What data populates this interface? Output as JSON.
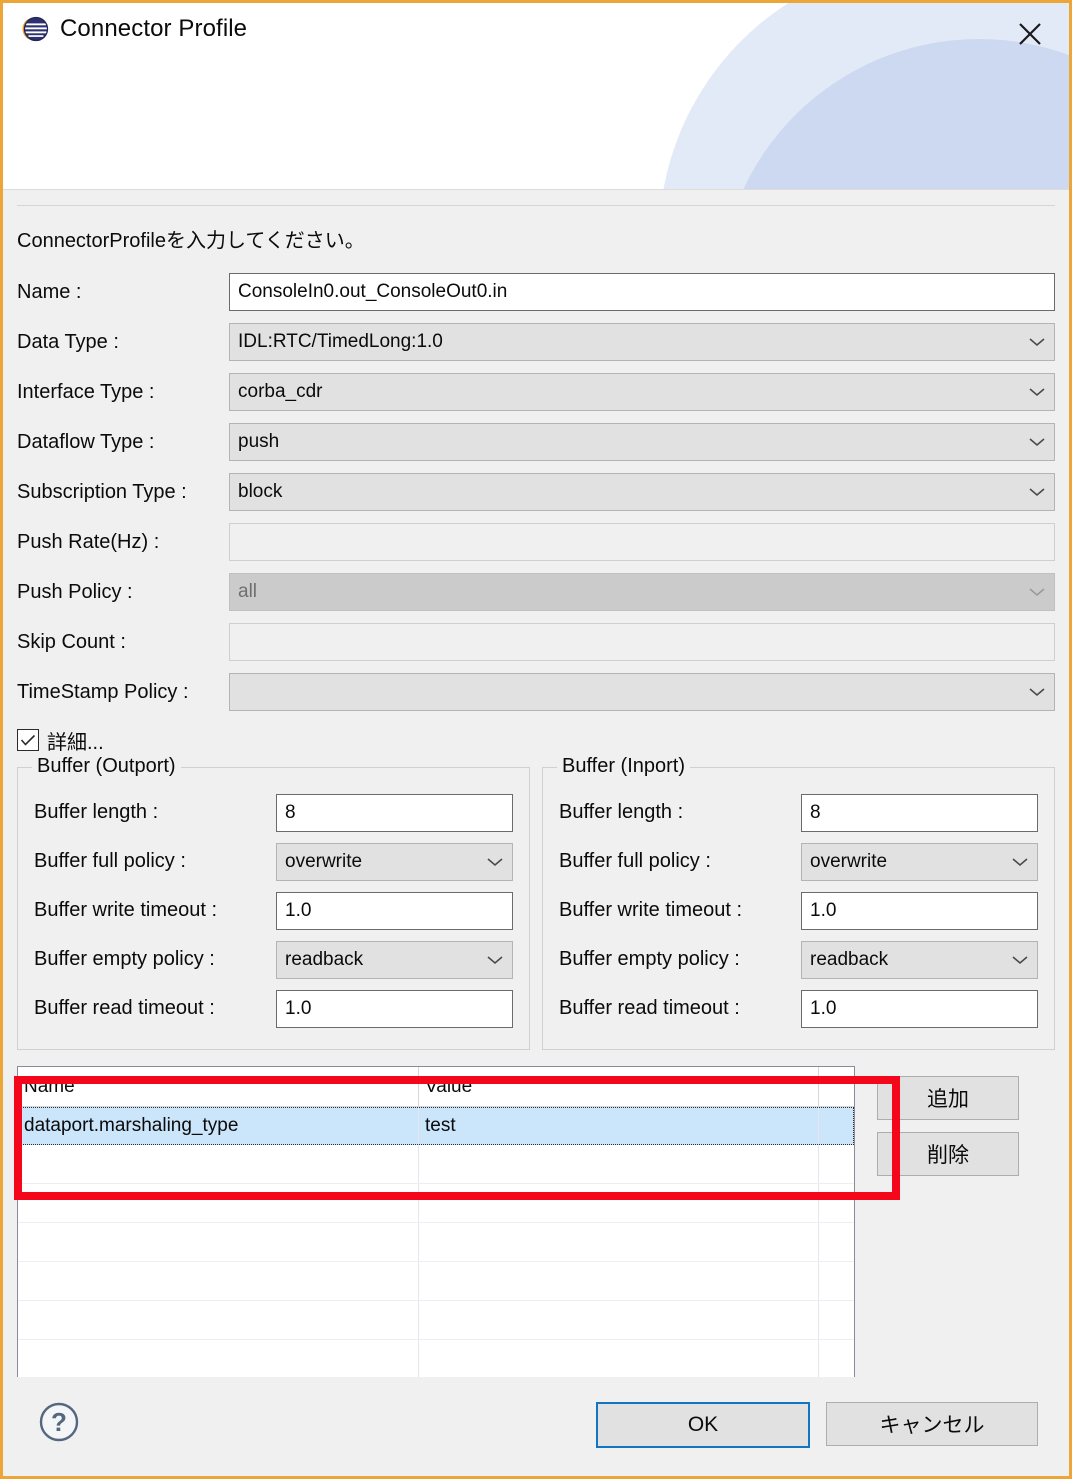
{
  "window": {
    "title": "Connector Profile",
    "app_icon": "connector-profile-icon",
    "close_icon": "close-icon",
    "border_color": "#eba637"
  },
  "intro": "ConnectorProfileを入力してください。",
  "form": {
    "fields": [
      {
        "label": "Name :",
        "value": "ConsoleIn0.out_ConsoleOut0.in",
        "type": "text",
        "state": "enabled"
      },
      {
        "label": "Data Type :",
        "value": "IDL:RTC/TimedLong:1.0",
        "type": "combo",
        "state": "enabled"
      },
      {
        "label": "Interface Type :",
        "value": "corba_cdr",
        "type": "combo",
        "state": "enabled"
      },
      {
        "label": "Dataflow Type :",
        "value": "push",
        "type": "combo",
        "state": "enabled"
      },
      {
        "label": "Subscription Type :",
        "value": "block",
        "type": "combo",
        "state": "enabled"
      },
      {
        "label": "Push Rate(Hz) :",
        "value": "",
        "type": "text",
        "state": "disabled"
      },
      {
        "label": "Push Policy :",
        "value": "all",
        "type": "combo",
        "state": "disabled"
      },
      {
        "label": "Skip Count :",
        "value": "",
        "type": "text",
        "state": "disabled"
      },
      {
        "label": "TimeStamp Policy :",
        "value": "",
        "type": "combo",
        "state": "disabled"
      }
    ]
  },
  "detail_checkbox": {
    "label": "詳細...",
    "checked": true
  },
  "buffer_outport": {
    "title": "Buffer (Outport)",
    "rows": [
      {
        "label": "Buffer length :",
        "value": "8",
        "type": "text"
      },
      {
        "label": "Buffer full policy :",
        "value": "overwrite",
        "type": "combo"
      },
      {
        "label": "Buffer write timeout :",
        "value": "1.0",
        "type": "text"
      },
      {
        "label": "Buffer empty policy :",
        "value": "readback",
        "type": "combo"
      },
      {
        "label": "Buffer read timeout :",
        "value": "1.0",
        "type": "text"
      }
    ]
  },
  "buffer_inport": {
    "title": "Buffer (Inport)",
    "rows": [
      {
        "label": "Buffer length :",
        "value": "8",
        "type": "text"
      },
      {
        "label": "Buffer full policy :",
        "value": "overwrite",
        "type": "combo"
      },
      {
        "label": "Buffer write timeout :",
        "value": "1.0",
        "type": "text"
      },
      {
        "label": "Buffer empty policy :",
        "value": "readback",
        "type": "combo"
      },
      {
        "label": "Buffer read timeout :",
        "value": "1.0",
        "type": "text"
      }
    ]
  },
  "properties_table": {
    "columns": [
      "Name",
      "Value"
    ],
    "rows": [
      {
        "name": "dataport.marshaling_type",
        "value": "test",
        "selected": true
      },
      {
        "name": "",
        "value": "",
        "selected": false
      },
      {
        "name": "",
        "value": "",
        "selected": false
      },
      {
        "name": "",
        "value": "",
        "selected": false
      },
      {
        "name": "",
        "value": "",
        "selected": false
      },
      {
        "name": "",
        "value": "",
        "selected": false
      },
      {
        "name": "",
        "value": "",
        "selected": false
      }
    ],
    "selection_color": "#cbe5fb"
  },
  "side_buttons": {
    "add_label": "追加",
    "delete_label": "削除"
  },
  "annotation": {
    "color": "#f4071a",
    "shape": "rectangle-highlight"
  },
  "footer": {
    "help_icon": "help-question-icon",
    "ok_label": "OK",
    "cancel_label": "キャンセル",
    "focus_color": "#1175c4"
  }
}
